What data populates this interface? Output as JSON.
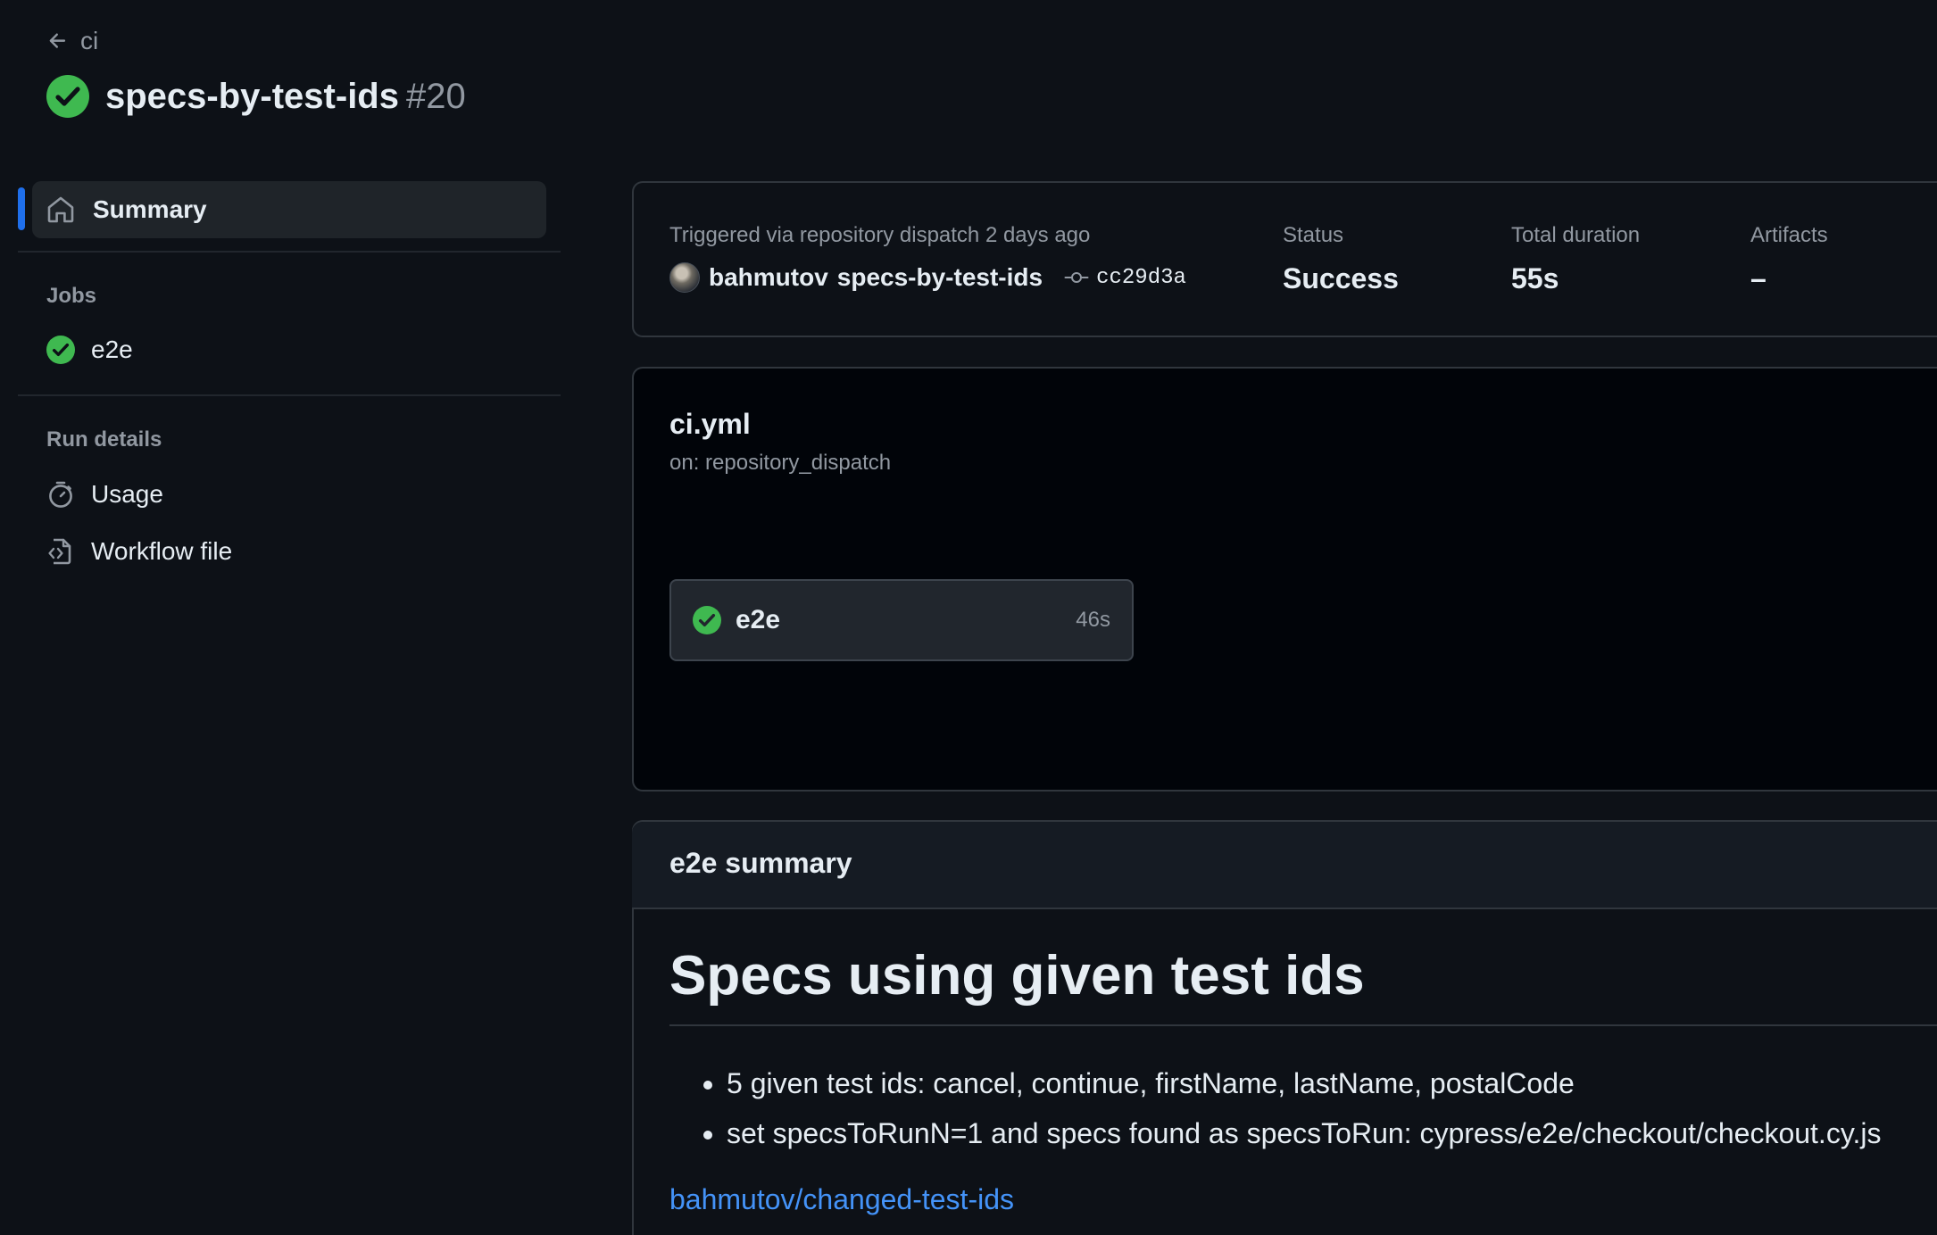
{
  "header": {
    "back_label": "ci",
    "title": "specs-by-test-ids",
    "run_number": "#20"
  },
  "sidebar": {
    "summary_label": "Summary",
    "jobs_heading": "Jobs",
    "jobs": [
      {
        "label": "e2e",
        "status": "success"
      }
    ],
    "run_details_heading": "Run details",
    "run_details": [
      {
        "label": "Usage",
        "icon": "stopwatch-icon"
      },
      {
        "label": "Workflow file",
        "icon": "file-code-icon"
      }
    ]
  },
  "run_info": {
    "trigger_text": "Triggered via repository dispatch 2 days ago",
    "actor": "bahmutov",
    "branch": "specs-by-test-ids",
    "commit": "cc29d3a",
    "status_label": "Status",
    "status_value": "Success",
    "duration_label": "Total duration",
    "duration_value": "55s",
    "artifacts_label": "Artifacts",
    "artifacts_value": "–"
  },
  "workflow": {
    "file_name": "ci.yml",
    "event": "on: repository_dispatch",
    "job": {
      "name": "e2e",
      "duration": "46s"
    }
  },
  "job_summary": {
    "heading": "e2e summary",
    "title": "Specs using given test ids",
    "bullets": [
      "5 given test ids: cancel, continue, firstName, lastName, postalCode",
      "set specsToRunN=1 and specs found as specsToRun: cypress/e2e/checkout/checkout.cy.js"
    ],
    "link_text": "bahmutov/changed-test-ids"
  },
  "colors": {
    "success": "#3fb950",
    "accent": "#1f6feb",
    "link": "#4493f8",
    "background": "#0d1117"
  }
}
